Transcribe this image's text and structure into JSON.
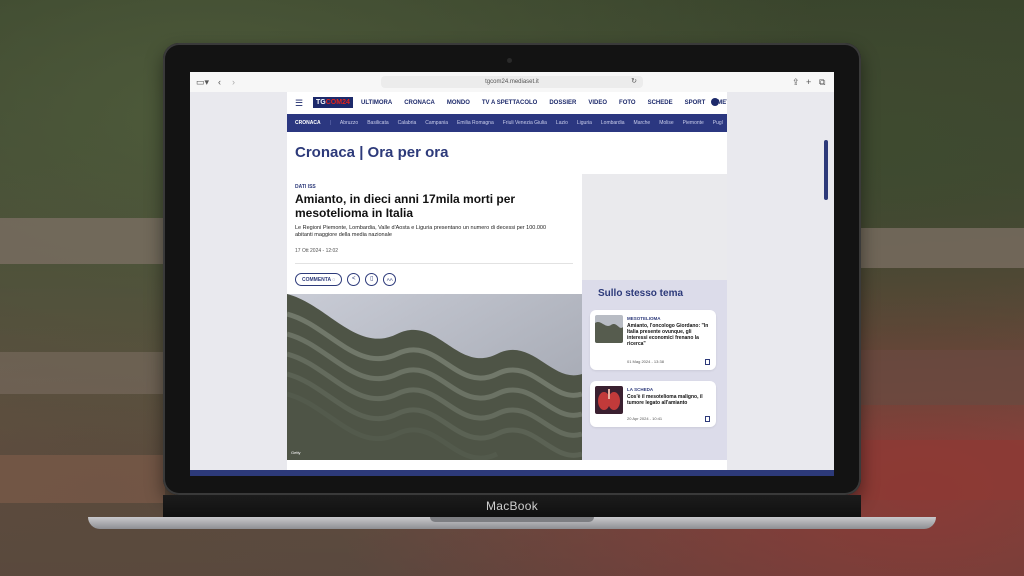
{
  "device": {
    "brand_label": "MacBook"
  },
  "browser": {
    "url": "tgcom24.mediaset.it"
  },
  "site": {
    "logo_text_a": "TG",
    "logo_text_b": "COM24",
    "nav": [
      "ULTIMORA",
      "CRONACA",
      "MONDO",
      "TV A SPETTACOLO",
      "DOSSIER",
      "VIDEO",
      "FOTO",
      "SCHEDE",
      "SPORT",
      "METEO"
    ],
    "subnav_current": "CRONACA",
    "subnav": [
      "Abruzzo",
      "Basilicata",
      "Calabria",
      "Campania",
      "Emilia Romagna",
      "Friuli Venezia Giulia",
      "Lazio",
      "Liguria",
      "Lombardia",
      "Marche",
      "Molise",
      "Piemonte",
      "Pugl"
    ]
  },
  "article": {
    "section_title": "Cronaca | Ora per ora",
    "kicker": "DATI ISS",
    "headline": "Amianto, in dieci anni 17mila morti per mesotelioma in Italia",
    "subtitle": "Le Regioni Piemonte, Lombardia, Valle d'Aosta e Liguria presentano un numero di decessi per 100.000 abitanti maggiore della media nazionale",
    "date": "17 Ott 2024 - 12:02",
    "comment_label": "COMMENTA",
    "font_label": "AA",
    "image_credit": "Getty"
  },
  "related": {
    "title": "Sullo stesso tema",
    "cards": [
      {
        "kicker": "MESOTELIOMA",
        "title": "Amianto, l'oncologo Giordano: \"In Italia presente ovunque, gli interessi economici frenano la ricerca\"",
        "date": "01 Mag 2024 - 13:38"
      },
      {
        "kicker": "LA SCHEDA",
        "title": "Cos'è il mesotelioma maligno, il tumore legato all'amianto",
        "date": "20 Apr 2024 - 10:41"
      }
    ]
  },
  "colors": {
    "brand_blue": "#2d3a7a",
    "brand_red": "#e2231a"
  }
}
